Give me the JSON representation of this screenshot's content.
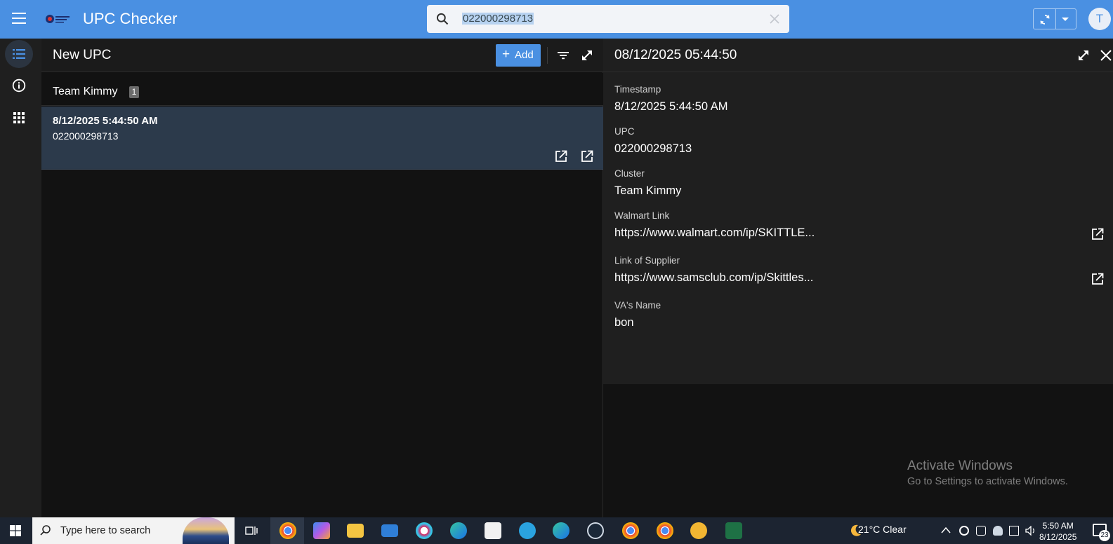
{
  "header": {
    "app_title": "UPC Checker",
    "search_value": "022000298713",
    "avatar_initial": "T"
  },
  "rail": {
    "items": [
      {
        "icon": "list-icon",
        "active": true
      },
      {
        "icon": "info-icon",
        "active": false
      },
      {
        "icon": "apps-grid-icon",
        "active": false
      }
    ]
  },
  "list": {
    "title": "New UPC",
    "add_label": "Add",
    "group": {
      "name": "Team Kimmy",
      "count": "1"
    },
    "items": [
      {
        "timestamp": "8/12/2025 5:44:50 AM",
        "upc": "022000298713"
      }
    ]
  },
  "detail": {
    "title": "08/12/2025 05:44:50",
    "fields": [
      {
        "label": "Timestamp",
        "value": "8/12/2025 5:44:50 AM",
        "link": false
      },
      {
        "label": "UPC",
        "value": "022000298713",
        "link": false
      },
      {
        "label": "Cluster",
        "value": "Team Kimmy",
        "link": false
      },
      {
        "label": "Walmart Link",
        "value": "https://www.walmart.com/ip/SKITTLE...",
        "link": true
      },
      {
        "label": "Link of Supplier",
        "value": "https://www.samsclub.com/ip/Skittles...",
        "link": true
      },
      {
        "label": "VA's Name",
        "value": "bon",
        "link": false
      }
    ]
  },
  "watermark": {
    "line1": "Activate Windows",
    "line2": "Go to Settings to activate Windows."
  },
  "taskbar": {
    "search_placeholder": "Type here to search",
    "weather": "21°C  Clear",
    "time": "5:50 AM",
    "date": "8/12/2025",
    "notification_count": "23"
  },
  "colors": {
    "accent": "#4a90e2",
    "selected_row": "#2c3a4b",
    "panel": "#1f1f1f",
    "background": "#121212"
  }
}
